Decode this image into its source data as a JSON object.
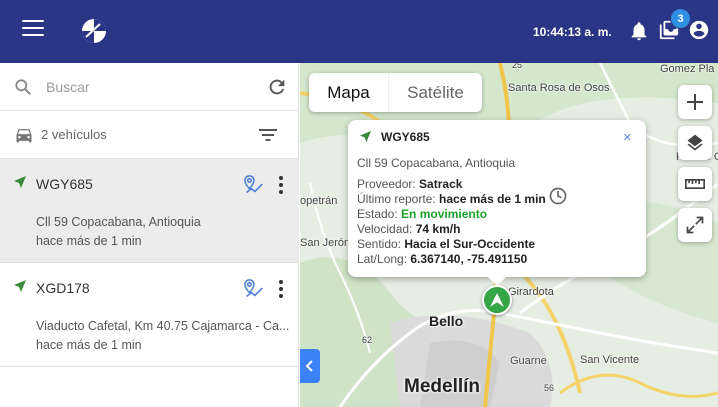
{
  "header": {
    "time": "10:44:13 a. m.",
    "notifications_badge": "3",
    "bar_color": "#2b3585"
  },
  "sidebar": {
    "search_placeholder": "Buscar",
    "vehicle_count": "2 vehículos",
    "vehicles": [
      {
        "plate": "WGY685",
        "address": "Cll 59 Copacabana, Antioquia",
        "last_report": "hace más de 1 min",
        "selected": true
      },
      {
        "plate": "XGD178",
        "address": "Viaducto Cafetal, Km 40.75 Cajamarca - Ca...",
        "last_report": "hace más de 1 min",
        "selected": false
      }
    ]
  },
  "map": {
    "type_buttons": {
      "map": "Mapa",
      "satellite": "Satélite"
    },
    "places": {
      "gomez_plata": "Gomez Pla",
      "santa_rosa": "Santa Rosa de Osos",
      "copetran": "opetrán",
      "san_jeronimo": "San Jerónim",
      "puente": "Puente G",
      "girardota": "Girardota",
      "bello": "Bello",
      "guarne": "Guarne",
      "san_vicente": "San Vicente",
      "medellin": "Medellín",
      "road_25": "25",
      "road_62": "62",
      "road_56": "56"
    },
    "info_window": {
      "plate": "WGY685",
      "address": "Cll 59 Copacabana, Antioquia",
      "provider_label": "Proveedor:",
      "provider": "Satrack",
      "last_report_label": "Último reporte:",
      "last_report": "hace más de 1 min",
      "status_label": "Estado:",
      "status": "En movimiento",
      "speed_label": "Velocidad:",
      "speed": "74 km/h",
      "direction_label": "Sentido:",
      "direction": "Hacia el Sur-Occidente",
      "latlong_label": "Lat/Long:",
      "latlong": "6.367140, -75.491150",
      "status_color": "#1aa12a"
    }
  },
  "icons": [
    "menu-icon",
    "logo-icon",
    "bell-icon",
    "inbox-icon",
    "account-icon",
    "search-icon",
    "refresh-icon",
    "car-icon",
    "filter-icon",
    "navigation-arrow-icon",
    "route-icon",
    "more-vert-icon",
    "plus-icon",
    "layers-icon",
    "ruler-icon",
    "fullscreen-icon",
    "chevron-left-icon",
    "clock-icon",
    "close-icon"
  ]
}
